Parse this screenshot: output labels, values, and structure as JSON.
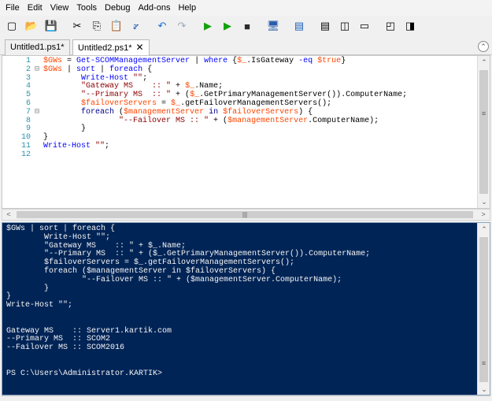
{
  "menu": [
    "File",
    "Edit",
    "View",
    "Tools",
    "Debug",
    "Add-ons",
    "Help"
  ],
  "toolbar_icons": [
    "new-file-icon",
    "open-folder-icon",
    "save-icon",
    "sep",
    "cut-icon",
    "copy-icon",
    "paste-icon",
    "clear-icon",
    "sep",
    "undo-icon",
    "redo-icon",
    "sep",
    "run-icon",
    "run-selection-icon",
    "stop-icon",
    "sep",
    "remote-powershell-icon",
    "sep",
    "powershell-icon",
    "sep",
    "layout-script-top-icon",
    "layout-script-right-icon",
    "layout-script-max-icon",
    "sep",
    "show-commands-icon",
    "show-addon-icon"
  ],
  "toolbar_glyphs": [
    "▢",
    "📂",
    "💾",
    "",
    "✂",
    "⎘",
    "📋",
    "⦫",
    "",
    "↶",
    "↷",
    "",
    "▶",
    "▶",
    "■",
    "",
    "🖥",
    "",
    "▤",
    "",
    "▤",
    "◫",
    "▭",
    "",
    "◰",
    "◨"
  ],
  "tabs": [
    {
      "label": "Untitled1.ps1*",
      "active": false
    },
    {
      "label": "Untitled2.ps1*",
      "active": true,
      "close": "✕"
    }
  ],
  "collapse_glyph": "⌃",
  "editor": {
    "lines": [
      {
        "n": "1",
        "fold": "",
        "html": "<span class=\"v\">$GWs</span> = <span class=\"c\">Get-SCOMManagementServer</span> | <span class=\"c\">where</span> {<span class=\"v\">$_</span>.IsGateway <span class=\"c\">-eq</span> <span class=\"v\">$true</span>}"
      },
      {
        "n": "2",
        "fold": "⊟",
        "html": "<span class=\"v\">$GWs</span> | <span class=\"c\">sort</span> | <span class=\"c\">foreach</span> {"
      },
      {
        "n": "3",
        "fold": "",
        "html": "        <span class=\"c\">Write-Host</span> <span class=\"s\">\"\"</span>;"
      },
      {
        "n": "4",
        "fold": "",
        "html": "        <span class=\"s\">\"Gateway MS    :: \"</span> + <span class=\"v\">$_</span>.Name;"
      },
      {
        "n": "5",
        "fold": "",
        "html": "        <span class=\"s\">\"--Primary MS  :: \"</span> + (<span class=\"v\">$_</span>.GetPrimaryManagementServer()).ComputerName;"
      },
      {
        "n": "6",
        "fold": "",
        "html": "        <span class=\"v\">$failoverServers</span> = <span class=\"v\">$_</span>.getFailoverManagementServers();"
      },
      {
        "n": "7",
        "fold": "⊟",
        "html": "        <span class=\"k\">foreach</span> (<span class=\"v\">$managementServer</span> <span class=\"k\">in</span> <span class=\"v\">$failoverServers</span>) {"
      },
      {
        "n": "8",
        "fold": "",
        "html": "                <span class=\"s\">\"--Failover MS :: \"</span> + (<span class=\"v\">$managementServer</span>.ComputerName);"
      },
      {
        "n": "9",
        "fold": "",
        "html": "        }"
      },
      {
        "n": "10",
        "fold": "",
        "html": "}"
      },
      {
        "n": "11",
        "fold": "",
        "html": "<span class=\"c\">Write-Host</span> <span class=\"s\">\"\"</span>;"
      },
      {
        "n": "12",
        "fold": "",
        "html": ""
      }
    ]
  },
  "console": {
    "lines": [
      "$GWs | sort | foreach {",
      "        Write-Host \"\";",
      "        \"Gateway MS    :: \" + $_.Name;",
      "        \"--Primary MS  :: \" + ($_.GetPrimaryManagementServer()).ComputerName;",
      "        $failoverServers = $_.getFailoverManagementServers();",
      "        foreach ($managementServer in $failoverServers) {",
      "                \"--Failover MS :: \" + ($managementServer.ComputerName);",
      "        }",
      "}",
      "Write-Host \"\";",
      "",
      "",
      "Gateway MS    :: Server1.kartik.com",
      "--Primary MS  :: SCOM2",
      "--Failover MS :: SCOM2016",
      "",
      "",
      "PS C:\\Users\\Administrator.KARTIK>"
    ]
  },
  "scroll_glyphs": {
    "up": "⌃",
    "down": "⌄",
    "left": "<",
    "right": ">",
    "grip_v": "≡",
    "grip_h": "|||"
  }
}
